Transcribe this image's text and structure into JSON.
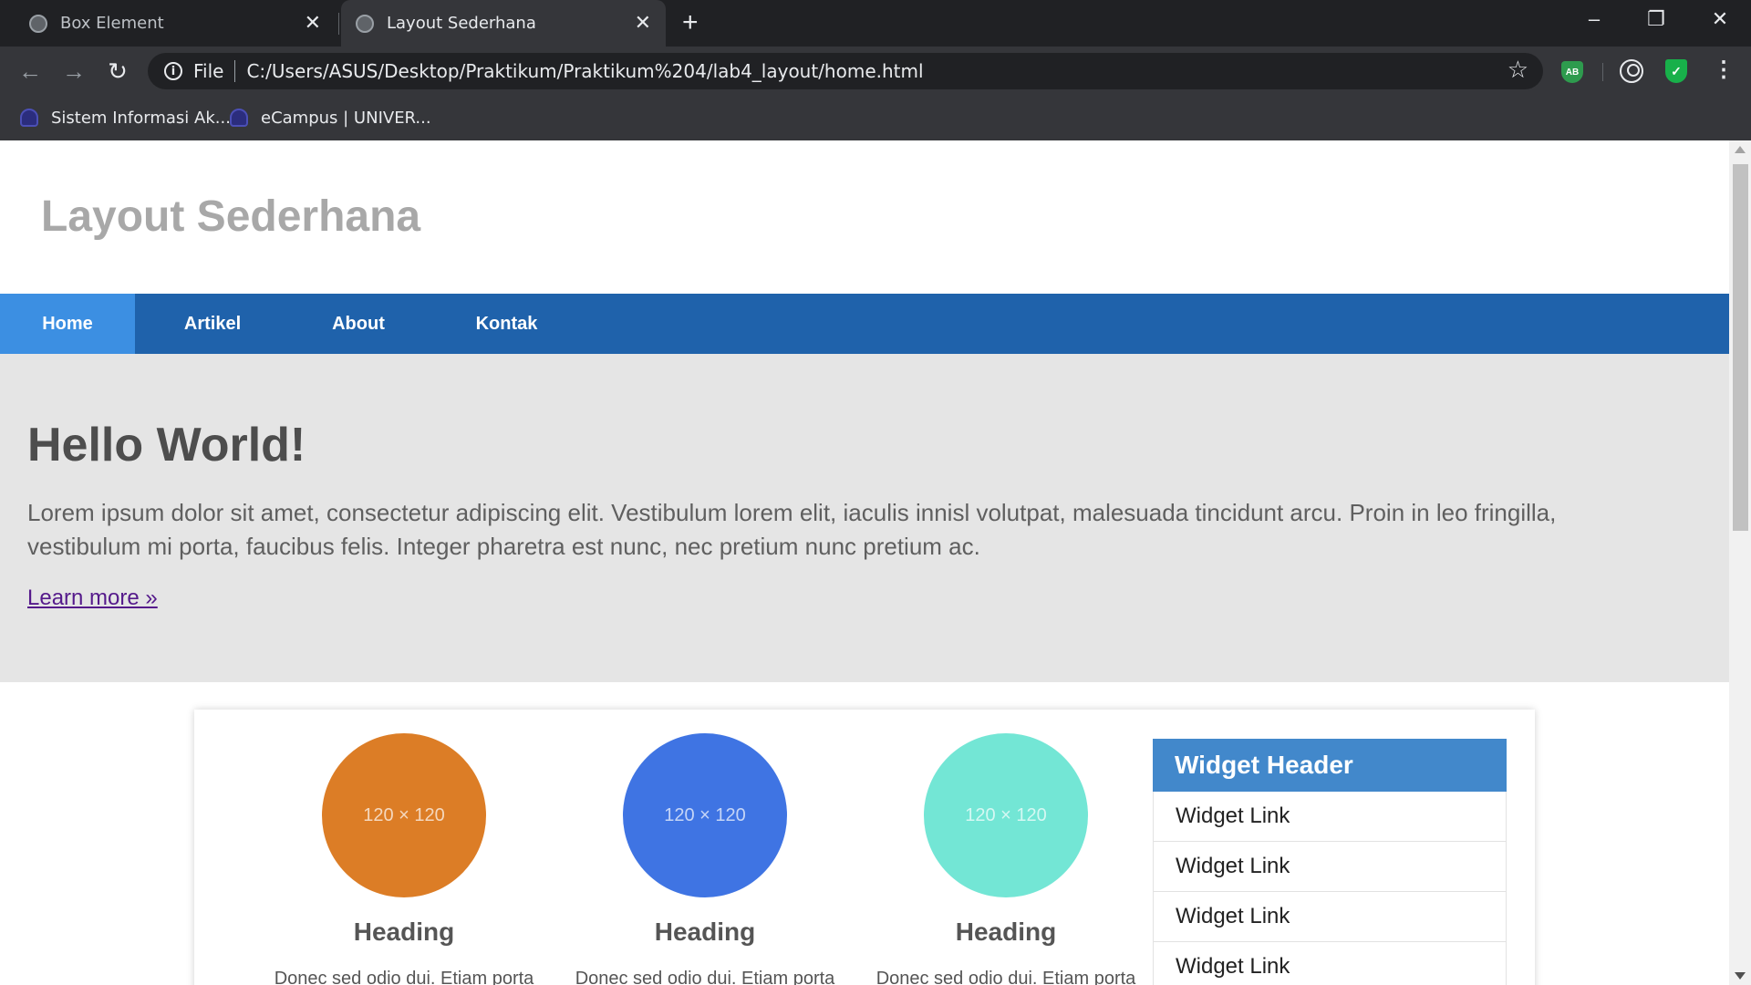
{
  "browser": {
    "tabs": [
      {
        "title": "Box Element",
        "active": false
      },
      {
        "title": "Layout Sederhana",
        "active": true
      }
    ],
    "address": {
      "scheme_label": "File",
      "url": "C:/Users/ASUS/Desktop/Praktikum/Praktikum%204/lab4_layout/home.html"
    },
    "extensions": {
      "adblock_label": "AB"
    },
    "bookmarks": [
      {
        "label": "Sistem Informasi Ak..."
      },
      {
        "label": "eCampus | UNIVER..."
      }
    ]
  },
  "site": {
    "title": "Layout Sederhana",
    "nav": [
      {
        "label": "Home",
        "active": true
      },
      {
        "label": "Artikel",
        "active": false
      },
      {
        "label": "About",
        "active": false
      },
      {
        "label": "Kontak",
        "active": false
      }
    ],
    "hero": {
      "title": "Hello World!",
      "text": "Lorem ipsum dolor sit amet, consectetur adipiscing elit. Vestibulum lorem elit, iaculis innisl volutpat, malesuada tincidunt arcu. Proin in leo fringilla, vestibulum mi porta, faucibus felis. Integer pharetra est nunc, nec pretium nunc pretium ac.",
      "link": "Learn more »"
    },
    "features": [
      {
        "image_label": "120 × 120",
        "color": "#dc7d26",
        "heading": "Heading",
        "text": "Donec sed odio dui. Etiam porta"
      },
      {
        "image_label": "120 × 120",
        "color": "#3f74e3",
        "heading": "Heading",
        "text": "Donec sed odio dui. Etiam porta"
      },
      {
        "image_label": "120 × 120",
        "color": "#73e6d5",
        "heading": "Heading",
        "text": "Donec sed odio dui. Etiam porta"
      }
    ],
    "widget": {
      "header": "Widget Header",
      "links": [
        "Widget Link",
        "Widget Link",
        "Widget Link",
        "Widget Link"
      ]
    }
  },
  "colors": {
    "nav_bg": "#1f62ab",
    "nav_active": "#3c8fe2",
    "hero_bg": "#e5e5e5",
    "widget_header": "#4288cb"
  }
}
